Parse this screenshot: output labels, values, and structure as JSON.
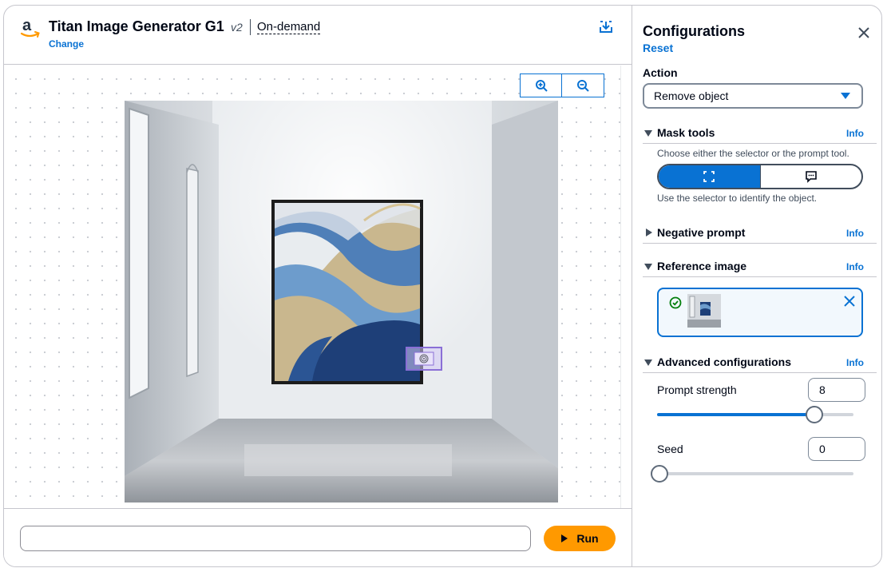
{
  "header": {
    "model_name": "Titan Image Generator G1",
    "version": "v2",
    "mode": "On-demand",
    "change_label": "Change",
    "icons": {
      "logo": "amazon-logo-icon",
      "save": "download-icon"
    }
  },
  "canvas": {
    "zoom_in_icon": "zoom-in-icon",
    "zoom_out_icon": "zoom-out-icon",
    "image_description_icon": "gallery-room-image"
  },
  "footer": {
    "prompt_value": "",
    "prompt_placeholder": "",
    "run_label": "Run"
  },
  "config": {
    "title": "Configurations",
    "reset_label": "Reset",
    "action": {
      "label": "Action",
      "selected": "Remove object"
    },
    "mask_tools": {
      "title": "Mask tools",
      "info": "Info",
      "description": "Choose either the selector or the prompt tool.",
      "hint": "Use the selector to identify the object.",
      "options": [
        "selector",
        "prompt"
      ]
    },
    "negative_prompt": {
      "title": "Negative prompt",
      "info": "Info"
    },
    "reference_image": {
      "title": "Reference image",
      "info": "Info"
    },
    "advanced": {
      "title": "Advanced configurations",
      "info": "Info",
      "prompt_strength": {
        "label": "Prompt strength",
        "value": "8",
        "fraction": 0.79
      },
      "seed": {
        "label": "Seed",
        "value": "0",
        "fraction": 0.0
      }
    }
  },
  "colors": {
    "accent": "#0972d3",
    "run": "#ff9900",
    "success": "#037f0c"
  }
}
